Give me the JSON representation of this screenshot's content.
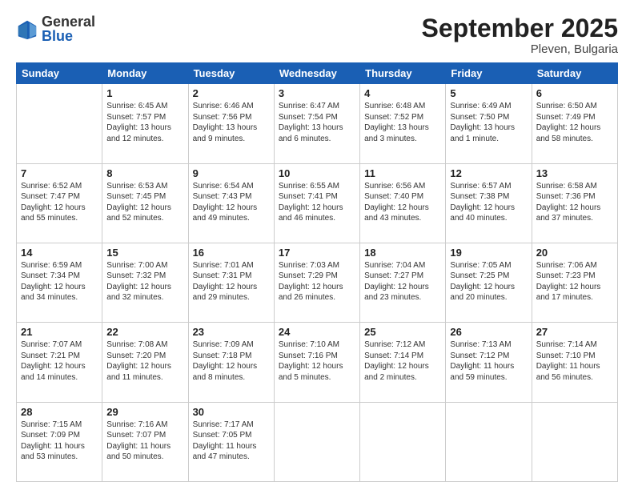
{
  "header": {
    "logo": {
      "general": "General",
      "blue": "Blue"
    },
    "title": "September 2025",
    "subtitle": "Pleven, Bulgaria"
  },
  "weekdays": [
    "Sunday",
    "Monday",
    "Tuesday",
    "Wednesday",
    "Thursday",
    "Friday",
    "Saturday"
  ],
  "weeks": [
    [
      {
        "day": "",
        "info": ""
      },
      {
        "day": "1",
        "info": "Sunrise: 6:45 AM\nSunset: 7:57 PM\nDaylight: 13 hours\nand 12 minutes."
      },
      {
        "day": "2",
        "info": "Sunrise: 6:46 AM\nSunset: 7:56 PM\nDaylight: 13 hours\nand 9 minutes."
      },
      {
        "day": "3",
        "info": "Sunrise: 6:47 AM\nSunset: 7:54 PM\nDaylight: 13 hours\nand 6 minutes."
      },
      {
        "day": "4",
        "info": "Sunrise: 6:48 AM\nSunset: 7:52 PM\nDaylight: 13 hours\nand 3 minutes."
      },
      {
        "day": "5",
        "info": "Sunrise: 6:49 AM\nSunset: 7:50 PM\nDaylight: 13 hours\nand 1 minute."
      },
      {
        "day": "6",
        "info": "Sunrise: 6:50 AM\nSunset: 7:49 PM\nDaylight: 12 hours\nand 58 minutes."
      }
    ],
    [
      {
        "day": "7",
        "info": "Sunrise: 6:52 AM\nSunset: 7:47 PM\nDaylight: 12 hours\nand 55 minutes."
      },
      {
        "day": "8",
        "info": "Sunrise: 6:53 AM\nSunset: 7:45 PM\nDaylight: 12 hours\nand 52 minutes."
      },
      {
        "day": "9",
        "info": "Sunrise: 6:54 AM\nSunset: 7:43 PM\nDaylight: 12 hours\nand 49 minutes."
      },
      {
        "day": "10",
        "info": "Sunrise: 6:55 AM\nSunset: 7:41 PM\nDaylight: 12 hours\nand 46 minutes."
      },
      {
        "day": "11",
        "info": "Sunrise: 6:56 AM\nSunset: 7:40 PM\nDaylight: 12 hours\nand 43 minutes."
      },
      {
        "day": "12",
        "info": "Sunrise: 6:57 AM\nSunset: 7:38 PM\nDaylight: 12 hours\nand 40 minutes."
      },
      {
        "day": "13",
        "info": "Sunrise: 6:58 AM\nSunset: 7:36 PM\nDaylight: 12 hours\nand 37 minutes."
      }
    ],
    [
      {
        "day": "14",
        "info": "Sunrise: 6:59 AM\nSunset: 7:34 PM\nDaylight: 12 hours\nand 34 minutes."
      },
      {
        "day": "15",
        "info": "Sunrise: 7:00 AM\nSunset: 7:32 PM\nDaylight: 12 hours\nand 32 minutes."
      },
      {
        "day": "16",
        "info": "Sunrise: 7:01 AM\nSunset: 7:31 PM\nDaylight: 12 hours\nand 29 minutes."
      },
      {
        "day": "17",
        "info": "Sunrise: 7:03 AM\nSunset: 7:29 PM\nDaylight: 12 hours\nand 26 minutes."
      },
      {
        "day": "18",
        "info": "Sunrise: 7:04 AM\nSunset: 7:27 PM\nDaylight: 12 hours\nand 23 minutes."
      },
      {
        "day": "19",
        "info": "Sunrise: 7:05 AM\nSunset: 7:25 PM\nDaylight: 12 hours\nand 20 minutes."
      },
      {
        "day": "20",
        "info": "Sunrise: 7:06 AM\nSunset: 7:23 PM\nDaylight: 12 hours\nand 17 minutes."
      }
    ],
    [
      {
        "day": "21",
        "info": "Sunrise: 7:07 AM\nSunset: 7:21 PM\nDaylight: 12 hours\nand 14 minutes."
      },
      {
        "day": "22",
        "info": "Sunrise: 7:08 AM\nSunset: 7:20 PM\nDaylight: 12 hours\nand 11 minutes."
      },
      {
        "day": "23",
        "info": "Sunrise: 7:09 AM\nSunset: 7:18 PM\nDaylight: 12 hours\nand 8 minutes."
      },
      {
        "day": "24",
        "info": "Sunrise: 7:10 AM\nSunset: 7:16 PM\nDaylight: 12 hours\nand 5 minutes."
      },
      {
        "day": "25",
        "info": "Sunrise: 7:12 AM\nSunset: 7:14 PM\nDaylight: 12 hours\nand 2 minutes."
      },
      {
        "day": "26",
        "info": "Sunrise: 7:13 AM\nSunset: 7:12 PM\nDaylight: 11 hours\nand 59 minutes."
      },
      {
        "day": "27",
        "info": "Sunrise: 7:14 AM\nSunset: 7:10 PM\nDaylight: 11 hours\nand 56 minutes."
      }
    ],
    [
      {
        "day": "28",
        "info": "Sunrise: 7:15 AM\nSunset: 7:09 PM\nDaylight: 11 hours\nand 53 minutes."
      },
      {
        "day": "29",
        "info": "Sunrise: 7:16 AM\nSunset: 7:07 PM\nDaylight: 11 hours\nand 50 minutes."
      },
      {
        "day": "30",
        "info": "Sunrise: 7:17 AM\nSunset: 7:05 PM\nDaylight: 11 hours\nand 47 minutes."
      },
      {
        "day": "",
        "info": ""
      },
      {
        "day": "",
        "info": ""
      },
      {
        "day": "",
        "info": ""
      },
      {
        "day": "",
        "info": ""
      }
    ]
  ]
}
